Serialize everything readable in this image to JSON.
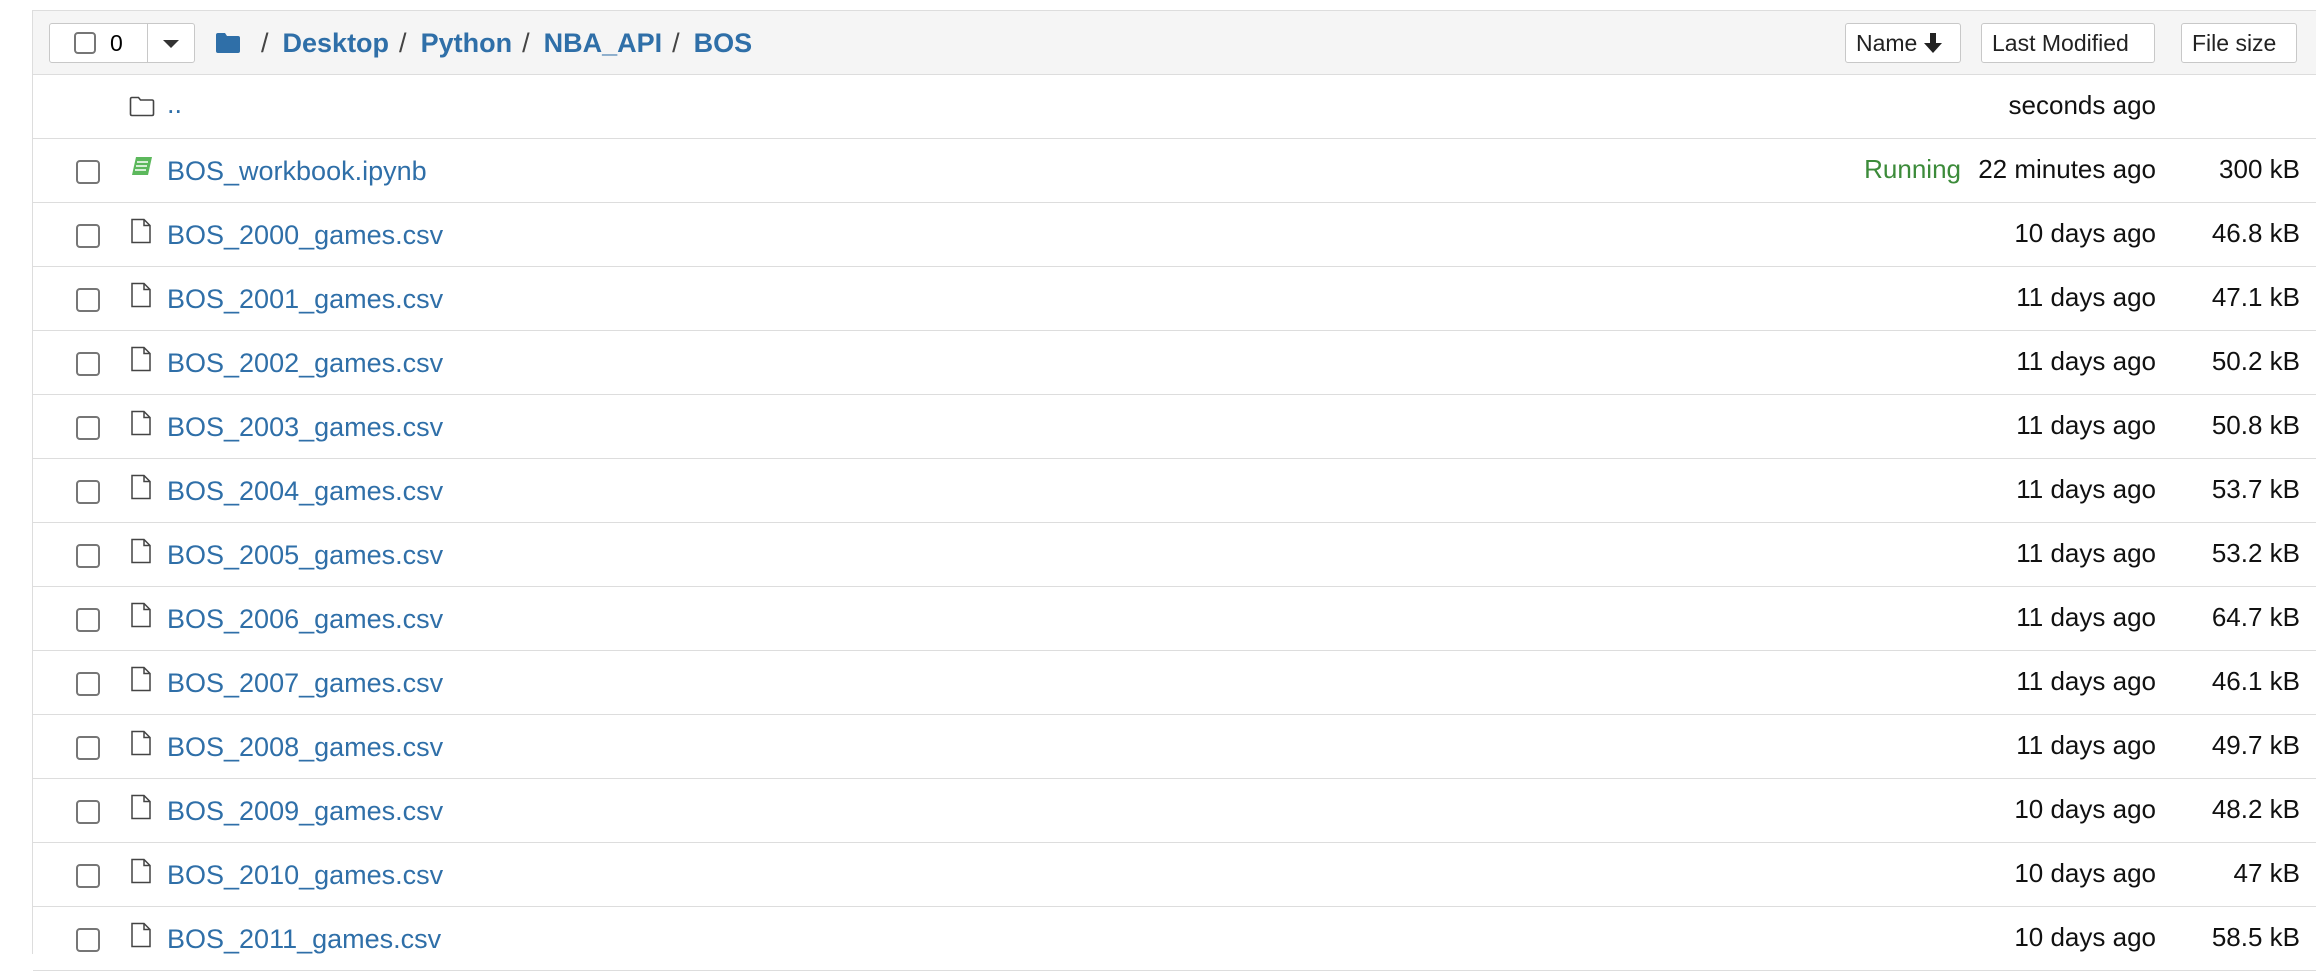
{
  "toolbar": {
    "selected_count": "0",
    "sort_name_label": "Name",
    "sort_modified_label": "Last Modified",
    "sort_size_label": "File size"
  },
  "breadcrumb": {
    "separator": "/",
    "items": [
      "Desktop",
      "Python",
      "NBA_API",
      "BOS"
    ]
  },
  "parent": {
    "name": "..",
    "modified": "seconds ago"
  },
  "files": [
    {
      "name": "BOS_workbook.ipynb",
      "type": "notebook",
      "status": "Running",
      "modified": "22 minutes ago",
      "size": "300 kB"
    },
    {
      "name": "BOS_2000_games.csv",
      "type": "file",
      "status": "",
      "modified": "10 days ago",
      "size": "46.8 kB"
    },
    {
      "name": "BOS_2001_games.csv",
      "type": "file",
      "status": "",
      "modified": "11 days ago",
      "size": "47.1 kB"
    },
    {
      "name": "BOS_2002_games.csv",
      "type": "file",
      "status": "",
      "modified": "11 days ago",
      "size": "50.2 kB"
    },
    {
      "name": "BOS_2003_games.csv",
      "type": "file",
      "status": "",
      "modified": "11 days ago",
      "size": "50.8 kB"
    },
    {
      "name": "BOS_2004_games.csv",
      "type": "file",
      "status": "",
      "modified": "11 days ago",
      "size": "53.7 kB"
    },
    {
      "name": "BOS_2005_games.csv",
      "type": "file",
      "status": "",
      "modified": "11 days ago",
      "size": "53.2 kB"
    },
    {
      "name": "BOS_2006_games.csv",
      "type": "file",
      "status": "",
      "modified": "11 days ago",
      "size": "64.7 kB"
    },
    {
      "name": "BOS_2007_games.csv",
      "type": "file",
      "status": "",
      "modified": "11 days ago",
      "size": "46.1 kB"
    },
    {
      "name": "BOS_2008_games.csv",
      "type": "file",
      "status": "",
      "modified": "11 days ago",
      "size": "49.7 kB"
    },
    {
      "name": "BOS_2009_games.csv",
      "type": "file",
      "status": "",
      "modified": "10 days ago",
      "size": "48.2 kB"
    },
    {
      "name": "BOS_2010_games.csv",
      "type": "file",
      "status": "",
      "modified": "10 days ago",
      "size": "47 kB"
    },
    {
      "name": "BOS_2011_games.csv",
      "type": "file",
      "status": "",
      "modified": "10 days ago",
      "size": "58.5 kB"
    }
  ],
  "colors": {
    "link": "#2f6fa8",
    "running": "#3c8b3a",
    "notebook_icon": "#5cb85c",
    "header_bg": "#f5f5f5"
  }
}
